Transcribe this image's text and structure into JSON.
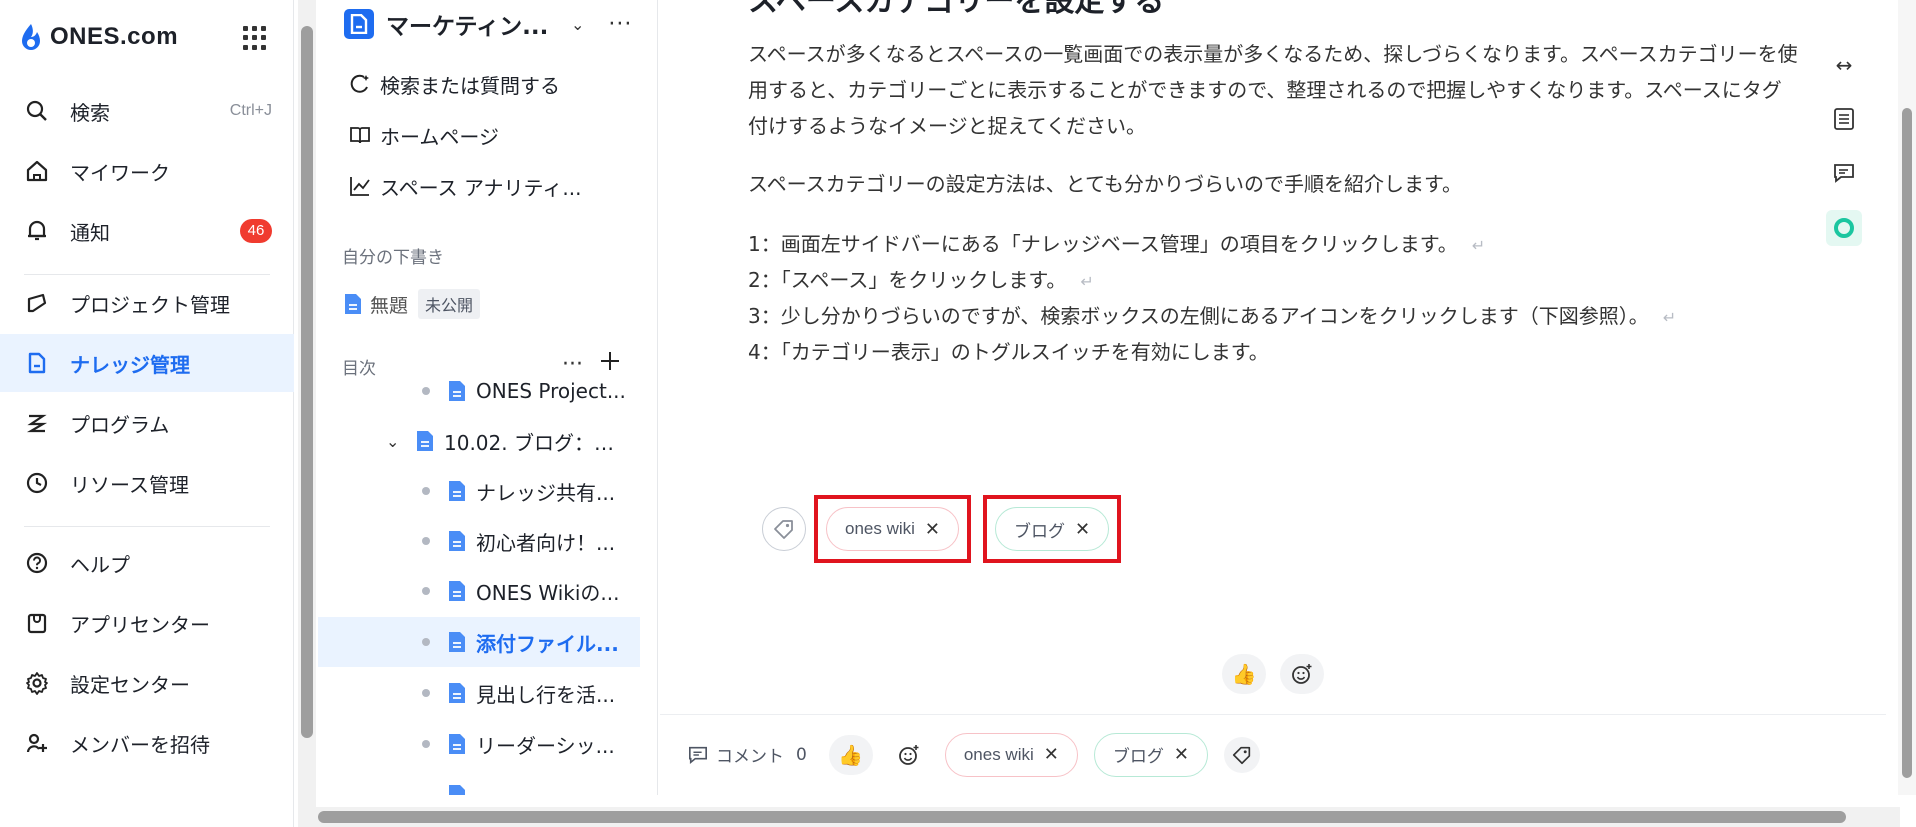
{
  "brand": {
    "logo_text": "ONES.com",
    "accent": "#1e6cf0",
    "badge_color": "#f03b2f",
    "tag_highlight": "#e0141e"
  },
  "nav": {
    "search": {
      "label": "検索",
      "shortcut": "Ctrl+J",
      "icon": "search-icon"
    },
    "my_work": {
      "label": "マイワーク",
      "icon": "home-icon"
    },
    "notify": {
      "label": "通知",
      "badge": "46",
      "icon": "bell-icon"
    },
    "project": {
      "label": "プロジェクト管理",
      "icon": "project-icon"
    },
    "knowledge": {
      "label": "ナレッジ管理",
      "icon": "knowledge-icon",
      "active": true
    },
    "program": {
      "label": "プログラム",
      "icon": "program-icon"
    },
    "resource": {
      "label": "リソース管理",
      "icon": "clock-icon"
    },
    "help": {
      "label": "ヘルプ",
      "icon": "help-icon"
    },
    "app_center": {
      "label": "アプリセンター",
      "icon": "app-center-icon"
    },
    "settings": {
      "label": "設定センター",
      "icon": "gear-icon"
    },
    "invite": {
      "label": "メンバーを招待",
      "icon": "invite-icon"
    }
  },
  "space": {
    "title": "マーケティング",
    "title_display": "マーケティン...",
    "links": {
      "ask": "検索または質問する",
      "home": "ホームページ",
      "analytics": "スペース アナリティ..."
    },
    "drafts_header": "自分の下書き",
    "draft": {
      "title": "無題",
      "status": "未公開"
    },
    "toc_header": "目次",
    "toc": [
      {
        "label": "ONES Project..."
      },
      {
        "label": "10.02. ブログ：O..."
      },
      {
        "label": "ナレッジ共有..."
      },
      {
        "label": "初心者向け！..."
      },
      {
        "label": "ONES Wikiの..."
      },
      {
        "label": "添付ファイル..."
      },
      {
        "label": "見出し行を活..."
      },
      {
        "label": "リーダーシッ..."
      }
    ]
  },
  "article": {
    "heading_partial": "スペースカテゴリーを設定する",
    "para1": "スペースが多くなるとスペースの一覧画面での表示量が多くなるため、探しづらくなります。スペースカテゴリーを使用すると、カテゴリーごとに表示することができますので、整理されるので把握しやすくなります。スペースにタグ付けするようなイメージと捉えてください。",
    "para2": "スペースカテゴリーの設定方法は、とても分かりづらいので手順を紹介します。",
    "steps": [
      "1：画面左サイドバーにある「ナレッジベース管理」の項目をクリックします。",
      "2：「スペース」をクリックします。",
      "3：少し分かりづらいのですが、検索ボックスの左側にあるアイコンをクリックします（下図参照）。",
      "4：「カテゴリー表示」のトグルスイッチを有効にします。"
    ],
    "return_mark": "↵",
    "tags": [
      "ones wiki",
      "ブログ"
    ]
  },
  "bottom_bar": {
    "comment_label": "コメント",
    "comment_count": "0",
    "tags": [
      "ones wiki",
      "ブログ"
    ]
  }
}
